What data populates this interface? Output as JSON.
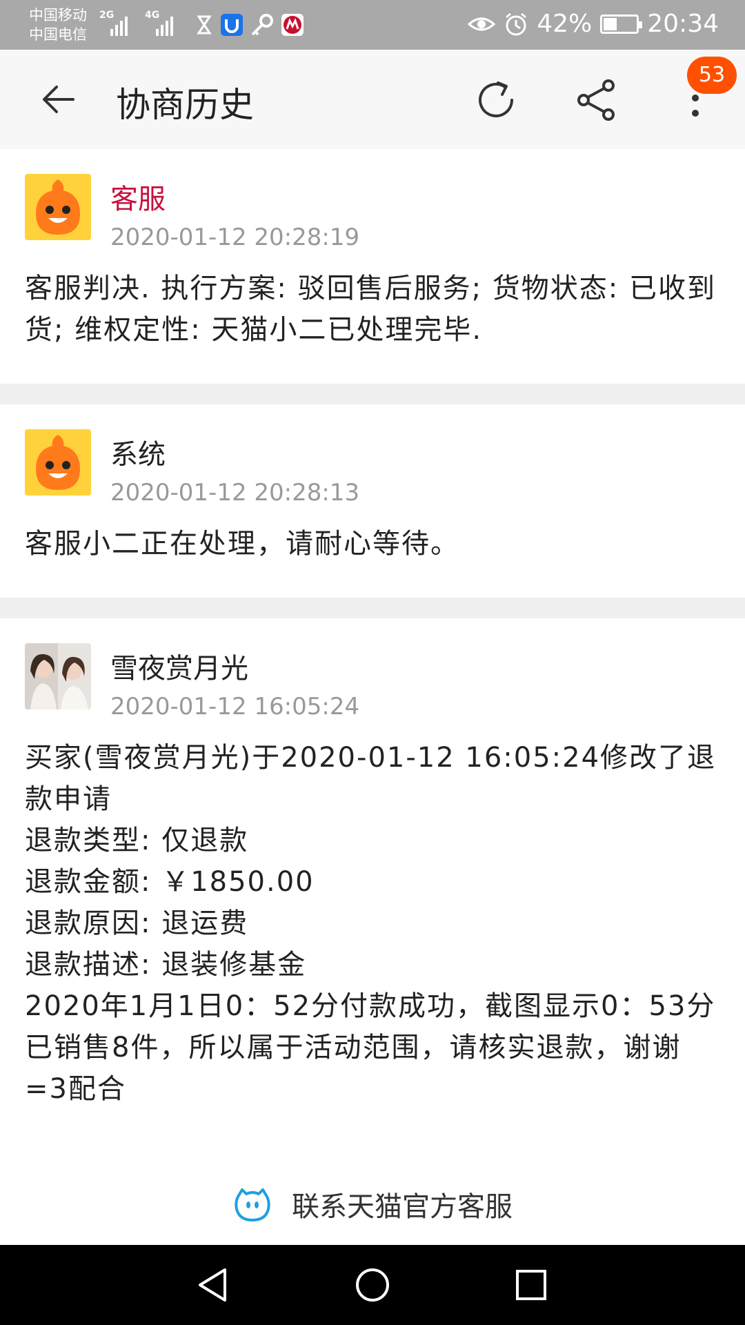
{
  "status_bar": {
    "carrier_1": "中国移动",
    "carrier_2": "中国电信",
    "net_1": "2G",
    "net_2": "4G",
    "battery": "42%",
    "battery_level": 0.42,
    "time": "20:34"
  },
  "app_bar": {
    "title": "协商历史",
    "badge_count": "53"
  },
  "history": [
    {
      "author": "客服",
      "time": "2020-01-12 20:28:19",
      "content": "客服判决. 执行方案: 驳回售后服务; 货物状态: 已收到货; 维权定性: 天猫小二已处理完毕."
    },
    {
      "author": "系统",
      "time": "2020-01-12 20:28:13",
      "content": "客服小二正在处理，请耐心等待。"
    },
    {
      "author": "雪夜赏月光",
      "time": "2020-01-12 16:05:24",
      "content": "买家(雪夜赏月光)于2020-01-12 16:05:24修改了退款申请\n退款类型: 仅退款\n退款金额: ￥1850.00\n退款原因: 退运费\n退款描述: 退装修基金\n2020年1月1日0：52分付款成功，截图显示0：53分已销售8件，所以属于活动范围，请核实退款，谢谢=3配合"
    }
  ],
  "contact": {
    "label": "联系天猫官方客服"
  },
  "colors": {
    "accent_red": "#c7103c",
    "badge": "#ff5000",
    "tmall_blue": "#1e9fe0"
  }
}
